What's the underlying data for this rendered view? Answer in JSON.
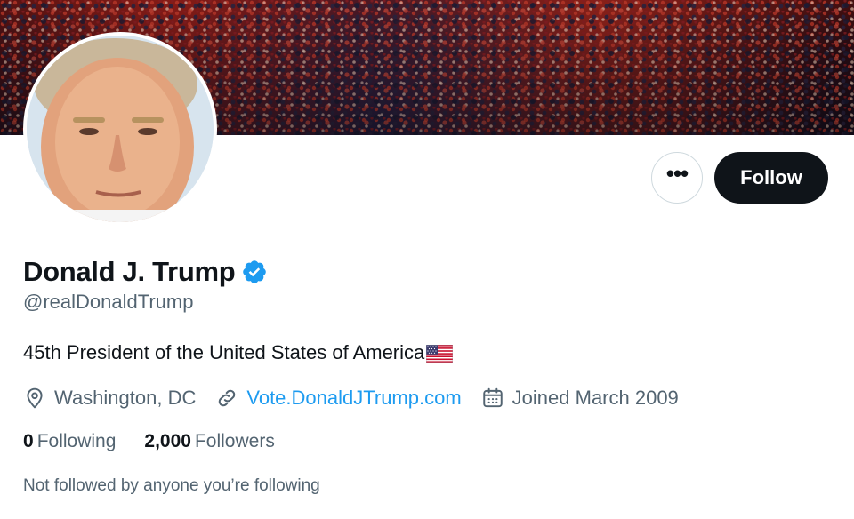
{
  "profile": {
    "display_name": "Donald J. Trump",
    "handle": "@realDonaldTrump",
    "bio": "45th President of the United States of America",
    "location": "Washington, DC",
    "website": "Vote.DonaldJTrump.com",
    "joined": "Joined March 2009",
    "following_count": "0",
    "following_label": "Following",
    "followers_count": "2,000",
    "followers_label": "Followers",
    "mutuals_note": "Not followed by anyone you’re following"
  },
  "actions": {
    "more_label": "•••",
    "follow_label": "Follow"
  },
  "icons": {
    "verified": "verified-badge-icon",
    "location": "location-pin-icon",
    "link": "link-icon",
    "calendar": "calendar-icon",
    "flag": "us-flag-emoji",
    "more": "more-options-icon"
  },
  "colors": {
    "text_primary": "#0f1419",
    "text_secondary": "#536471",
    "accent": "#1d9bf0",
    "follow_button": "#0f1419"
  }
}
